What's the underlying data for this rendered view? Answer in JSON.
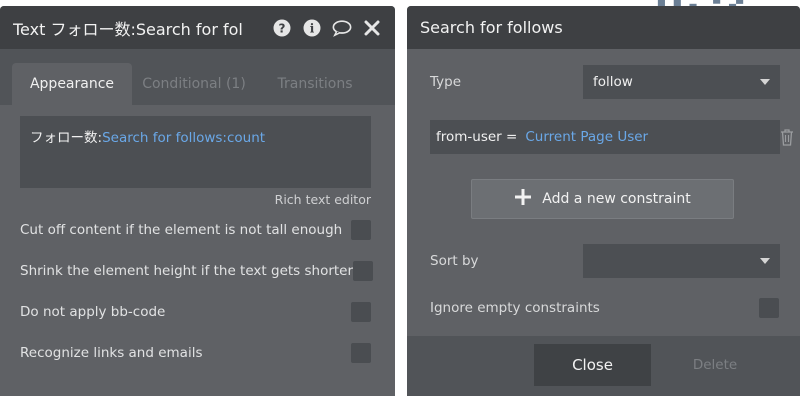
{
  "left_panel": {
    "title": "Text フォロー数:Search for fol",
    "tabs": [
      {
        "label": "Appearance"
      },
      {
        "label": "Conditional (1)"
      },
      {
        "label": "Transitions"
      }
    ],
    "editor": {
      "static_text": "フォロー数:",
      "dynamic_text": "Search for follows:count"
    },
    "rich_text_label": "Rich text editor",
    "options": [
      {
        "label": "Cut off content if the element is not tall enough"
      },
      {
        "label": "Shrink the element height if the text gets shorter"
      },
      {
        "label": "Do not apply bb-code"
      },
      {
        "label": "Recognize links and emails"
      }
    ]
  },
  "right_panel": {
    "title": "Search for follows",
    "type_label": "Type",
    "type_value": "follow",
    "constraint": {
      "key": "from-user =",
      "value": "Current Page User"
    },
    "add_constraint_label": "Add a new constraint",
    "sort_by_label": "Sort by",
    "sort_by_value": "",
    "ignore_empty_label": "Ignore empty constraints",
    "close_label": "Close",
    "delete_label": "Delete"
  },
  "colors": {
    "panel_bg": "#5f6165",
    "header_bg": "#3e4043",
    "dynamic_link": "#6aa8e8"
  }
}
